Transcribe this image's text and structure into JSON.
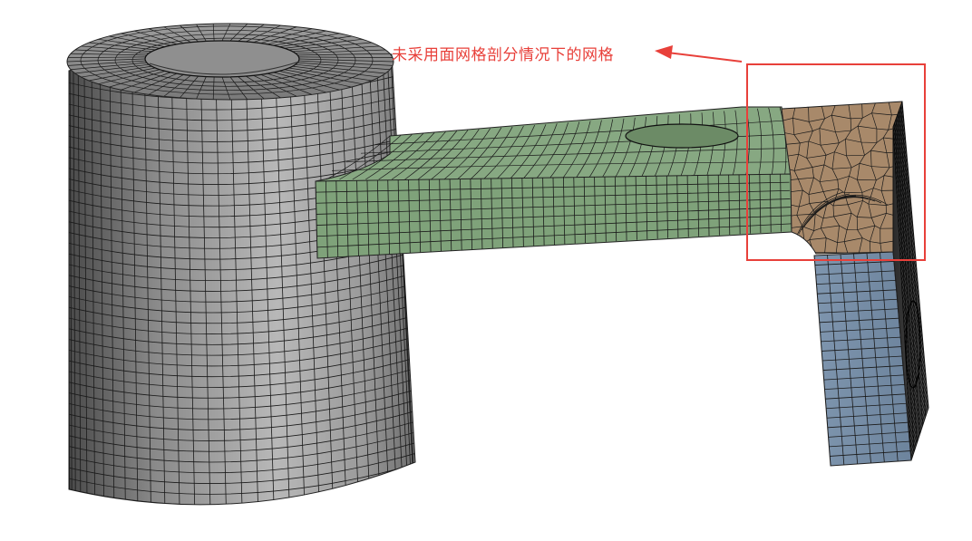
{
  "annotation": {
    "text": "未采用面网格剖分情况下的网格"
  },
  "colors": {
    "annotation": "#e8403a",
    "cylinder_light": "#b5b5b5",
    "cylinder_dark": "#5a5a5a",
    "arm_mesh": "#7fa27a",
    "corner_mesh": "#a88a6a",
    "leg_mesh": "#7d92ab",
    "mesh_line": "#1a1a1a",
    "highlight_box": "#e8403a"
  }
}
